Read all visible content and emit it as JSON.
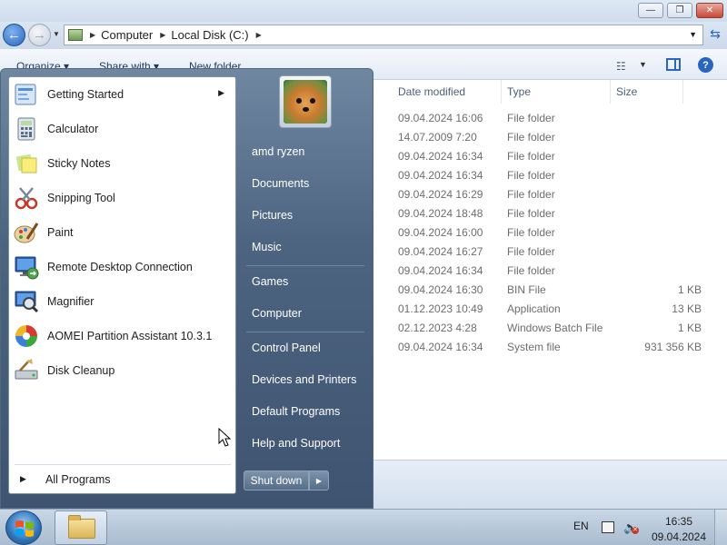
{
  "window": {
    "buttons": {
      "minimize": "—",
      "restore": "❐",
      "close": "✕"
    }
  },
  "address": {
    "segments": [
      "Computer",
      "Local Disk (C:)"
    ]
  },
  "toolbar": {
    "organize": "Organize ▾",
    "share_with": "Share with ▾",
    "new_folder": "New folder"
  },
  "columns": {
    "date_modified": "Date modified",
    "type": "Type",
    "size": "Size"
  },
  "files": [
    {
      "date": "09.04.2024 16:06",
      "type": "File folder",
      "size": ""
    },
    {
      "date": "14.07.2009 7:20",
      "type": "File folder",
      "size": ""
    },
    {
      "date": "09.04.2024 16:34",
      "type": "File folder",
      "size": ""
    },
    {
      "date": "09.04.2024 16:34",
      "type": "File folder",
      "size": ""
    },
    {
      "date": "09.04.2024 16:29",
      "type": "File folder",
      "size": ""
    },
    {
      "date": "09.04.2024 18:48",
      "type": "File folder",
      "size": ""
    },
    {
      "date": "09.04.2024 16:00",
      "type": "File folder",
      "size": ""
    },
    {
      "date": "09.04.2024 16:27",
      "type": "File folder",
      "size": ""
    },
    {
      "date": "09.04.2024 16:34",
      "type": "File folder",
      "size": ""
    },
    {
      "date": "09.04.2024 16:30",
      "type": "BIN File",
      "size": "1 KB"
    },
    {
      "date": "01.12.2023 10:49",
      "type": "Application",
      "size": "13 KB"
    },
    {
      "date": "02.12.2023 4:28",
      "type": "Windows Batch File",
      "size": "1 KB"
    },
    {
      "date": "09.04.2024 16:34",
      "type": "System file",
      "size": "931 356 KB"
    }
  ],
  "startmenu": {
    "programs": [
      {
        "label": "Getting Started",
        "icon": "getting-started-icon",
        "has_submenu": true
      },
      {
        "label": "Calculator",
        "icon": "calculator-icon"
      },
      {
        "label": "Sticky Notes",
        "icon": "sticky-notes-icon"
      },
      {
        "label": "Snipping Tool",
        "icon": "snipping-tool-icon"
      },
      {
        "label": "Paint",
        "icon": "paint-icon"
      },
      {
        "label": "Remote Desktop Connection",
        "icon": "remote-desktop-icon"
      },
      {
        "label": "Magnifier",
        "icon": "magnifier-icon"
      },
      {
        "label": "AOMEI Partition Assistant 10.3.1",
        "icon": "aomei-icon"
      },
      {
        "label": "Disk Cleanup",
        "icon": "disk-cleanup-icon"
      }
    ],
    "all_programs": "All Programs",
    "user": "amd ryzen",
    "right_items": [
      "Documents",
      "Pictures",
      "Music",
      "Games",
      "Computer",
      "Control Panel",
      "Devices and Printers",
      "Default Programs",
      "Help and Support"
    ],
    "shutdown": "Shut down"
  },
  "taskbar": {
    "language": "EN",
    "time": "16:35",
    "date": "09.04.2024"
  },
  "colors": {
    "startmenu_panel": "#4d6480",
    "accent_blue": "#2a66c1",
    "taskbar": "#b9c9db"
  }
}
